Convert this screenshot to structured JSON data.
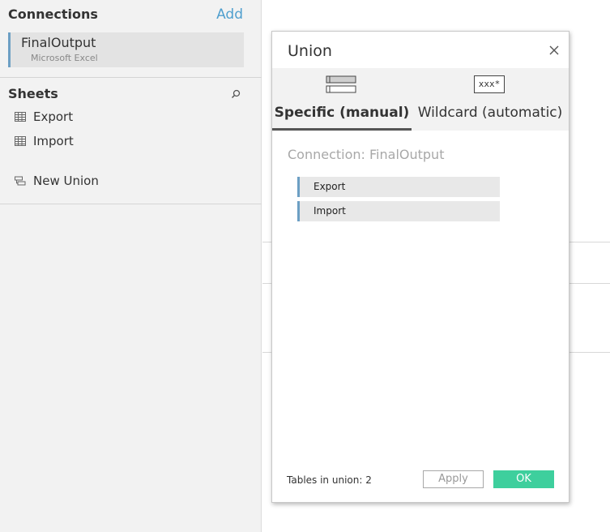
{
  "connections": {
    "title": "Connections",
    "add_label": "Add",
    "items": [
      {
        "name": "FinalOutput",
        "type": "Microsoft Excel"
      }
    ]
  },
  "sheets": {
    "title": "Sheets",
    "items": [
      {
        "label": "Export",
        "icon": "table-icon"
      },
      {
        "label": "Import",
        "icon": "table-icon"
      }
    ],
    "new_union": {
      "label": "New Union",
      "icon": "union-icon"
    }
  },
  "union_dialog": {
    "title": "Union",
    "tabs": [
      {
        "label": "Specific (manual)",
        "icon": "stacked-tables-icon",
        "selected": true
      },
      {
        "label": "Wildcard (automatic)",
        "icon": "wildcard-icon",
        "icon_text": "xxx*",
        "selected": false
      }
    ],
    "connection_label": "Connection: FinalOutput",
    "tables": [
      "Export",
      "Import"
    ],
    "tables_count": "Tables in union: 2",
    "apply_label": "Apply",
    "ok_label": "OK"
  },
  "colors": {
    "accent_blue": "#4f9fce",
    "ok_green": "#3ecf9d",
    "selection_bar": "#6c9fc4"
  }
}
